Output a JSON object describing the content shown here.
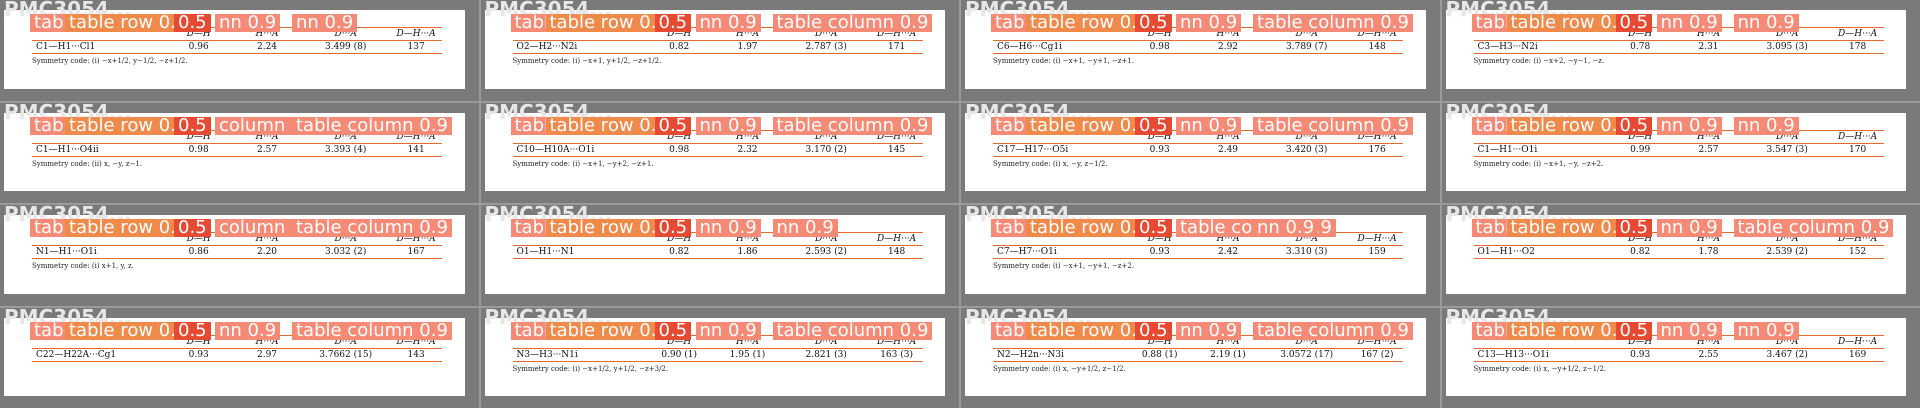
{
  "overlay_labels": {
    "row": "table row 0.9",
    "row_04": "table row 0.4",
    "row_05": "0.5",
    "col": "column 0.9",
    "col_short": "nn 0.9",
    "col_alt": "table column 0.9"
  },
  "table_headers": [
    "",
    "D—H",
    "H···A",
    "D···A",
    "D—H···A"
  ],
  "panels": [
    {
      "id": "PMC3054...",
      "row": [
        "C1—H1···Cl1",
        "0.96",
        "2.24",
        "3.499 (8)",
        "137"
      ],
      "symm": "Symmetry code: (i) −x+1/2, y−1/2, −z+1/2."
    },
    {
      "id": "PMC3054...",
      "row": [
        "O2—H2···N2i",
        "0.82",
        "1.97",
        "2.787 (3)",
        "171"
      ],
      "symm": "Symmetry code: (i) −x+1, y+1/2, −z+1/2."
    },
    {
      "id": "PMC3054...",
      "row": [
        "C6—H6···Cg1i",
        "0.98",
        "2.92",
        "3.789 (7)",
        "148"
      ],
      "symm": "Symmetry code: (i) −x+1, −y+1, −z+1."
    },
    {
      "id": "PMC3054...",
      "row": [
        "C3—H3···N2i",
        "0.78",
        "2.31",
        "3.095 (3)",
        "178"
      ],
      "symm": "Symmetry code: (i) −x+2, −y−1, −z."
    },
    {
      "id": "PMC3054...",
      "row": [
        "C1—H1···O4ii",
        "0.98",
        "2.57",
        "3.393 (4)",
        "141"
      ],
      "symm": "Symmetry code: (ii) x, −y, z−1."
    },
    {
      "id": "PMC3054...",
      "row": [
        "C10—H10A···O1i",
        "0.98",
        "2.32",
        "3.170 (2)",
        "145"
      ],
      "symm": "Symmetry code: (i) −x+1, −y+2, −z+1."
    },
    {
      "id": "PMC3054...",
      "row": [
        "C17—H17···O5i",
        "0.93",
        "2.49",
        "3.420 (3)",
        "176"
      ],
      "symm": "Symmetry code: (i) x, −y, z−1/2."
    },
    {
      "id": "PMC3054...",
      "row": [
        "C1—H1···O1i",
        "0.99",
        "2.57",
        "3.547 (3)",
        "170"
      ],
      "symm": "Symmetry code: (i) −x+1, −y, −z+2."
    },
    {
      "id": "PMC3054...",
      "row": [
        "N1—H1···O1i",
        "0.86",
        "2.20",
        "3.032 (2)",
        "167"
      ],
      "symm": "Symmetry code: (i) x+1, y, z."
    },
    {
      "id": "PMC3054...",
      "row": [
        "O1—H1···N1",
        "0.82",
        "1.86",
        "2.593 (2)",
        "148"
      ],
      "symm": ""
    },
    {
      "id": "PMC3054...",
      "row": [
        "C7—H7···O1i",
        "0.93",
        "2.42",
        "3.310 (3)",
        "159"
      ],
      "symm": "Symmetry code: (i) −x+1, −y+1, −z+2."
    },
    {
      "id": "PMC3054...",
      "row": [
        "O1—H1···O2",
        "0.82",
        "1.78",
        "2.539 (2)",
        "152"
      ],
      "symm": ""
    },
    {
      "id": "PMC3054...",
      "row": [
        "C22—H22A···Cg1",
        "0.93",
        "2.97",
        "3.7662 (15)",
        "143"
      ],
      "symm": ""
    },
    {
      "id": "PMC3054...",
      "row": [
        "N3—H3···N1i",
        "0.90 (1)",
        "1.95 (1)",
        "2.821 (3)",
        "163 (3)"
      ],
      "symm": "Symmetry code: (i) −x+1/2, y+1/2, −z+3/2."
    },
    {
      "id": "PMC3054...",
      "row": [
        "N2—H2n···N3i",
        "0.88 (1)",
        "2.19 (1)",
        "3.0572 (17)",
        "167 (2)"
      ],
      "symm": "Symmetry code: (i) x, −y+1/2, z−1/2."
    },
    {
      "id": "PMC3054...",
      "row": [
        "C13—H13···O1i",
        "0.93",
        "2.55",
        "3.467 (2)",
        "169"
      ],
      "symm": "Symmetry code: (i) x, −y+1/2, z−1/2."
    }
  ]
}
